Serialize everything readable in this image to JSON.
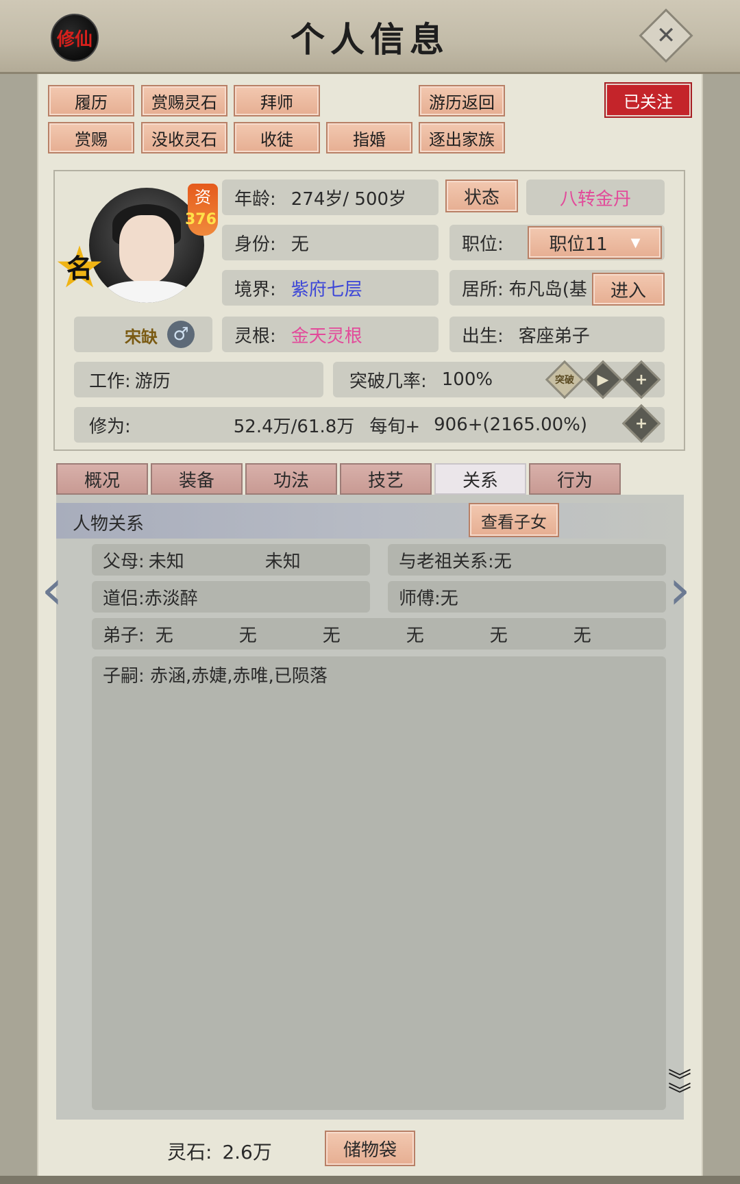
{
  "header": {
    "logo_text": "修仙",
    "title": "个人信息",
    "close_symbol": "✕"
  },
  "actions": {
    "row1": [
      "履历",
      "赏赐灵石",
      "拜师",
      "游历返回"
    ],
    "row2": [
      "赏赐",
      "没收灵石",
      "收徒",
      "指婚",
      "逐出家族"
    ],
    "followed_label": "已关注"
  },
  "profile": {
    "name": "宋缺",
    "gender_symbol": "♂",
    "zi_label": "资",
    "zi_value": "376",
    "fame_badge": "名",
    "age_label": "年龄:",
    "age_value": "274岁/ 500岁",
    "status_button": "状态",
    "status_value": "八转金丹",
    "identity_label": "身份:",
    "identity_value": "无",
    "position_label": "职位:",
    "position_value": "职位11",
    "realm_label": "境界:",
    "realm_value": "紫府七层",
    "residence_label": "居所:",
    "residence_value": "布凡岛(基",
    "enter_button": "进入",
    "root_label": "灵根:",
    "root_value": "金天灵根",
    "birth_label": "出生:",
    "birth_value": "客座弟子",
    "work_label": "工作:",
    "work_value": "游历",
    "breakthrough_label": "突破几率:",
    "breakthrough_value": "100%",
    "breakthrough_icon_text": "突破",
    "cultivation_label": "修为:",
    "cultivation_value": "52.4万/61.8万",
    "per_period_label": "每旬+",
    "per_period_value": "906+(2165.00%)"
  },
  "tabs": [
    "概况",
    "装备",
    "功法",
    "技艺",
    "关系",
    "行为"
  ],
  "active_tab": "关系",
  "relations": {
    "section_title": "人物关系",
    "view_children_button": "查看子女",
    "parents_label": "父母:",
    "parent1": "未知",
    "parent2": "未知",
    "ancestor_label": "与老祖关系:",
    "ancestor_value": "无",
    "partner_label": "道侣:",
    "partner_value": "赤淡醉",
    "master_label": "师傅:",
    "master_value": "无",
    "disciples_label": "弟子:",
    "disciples": [
      "无",
      "无",
      "无",
      "无",
      "无",
      "无"
    ],
    "children_label": "子嗣:",
    "children_value": "赤涵,赤婕,赤唯,已陨落"
  },
  "footer": {
    "spirit_stone_label": "灵石:",
    "spirit_stone_value": "2.6万",
    "storage_button": "储物袋"
  },
  "colors": {
    "accent_red": "#c4242a",
    "realm_blue": "#3c46d8",
    "root_pink": "#e24a9a",
    "button_salmon": "#e6ae92"
  }
}
